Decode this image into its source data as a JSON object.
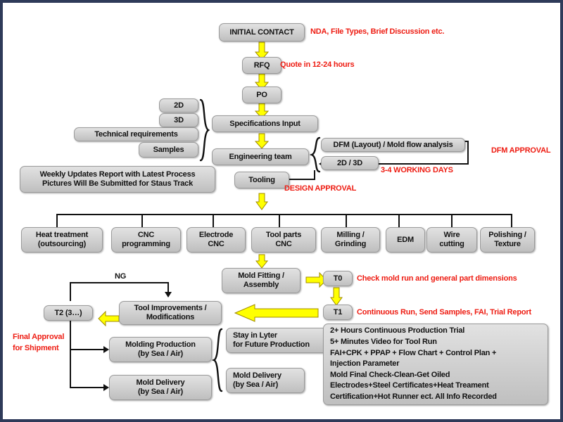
{
  "diagram": {
    "title": "Mold Manufacturing Process Flow",
    "colors": {
      "frame_border": "#2e3a59",
      "background": "#ffffff",
      "box_fill": "#d2d2d2",
      "annotation_red": "#ee1c12",
      "arrow_yellow": "#ffff00",
      "connector_black": "#111111"
    },
    "nodes": {
      "initial_contact": "INITIAL CONTACT",
      "rfq": "RFQ",
      "po": "PO",
      "two_d": "2D",
      "three_d": "3D",
      "technical_requirements": "Technical requirements",
      "samples": "Samples",
      "specifications_input": "Specifications Input",
      "engineering_team": "Engineering team",
      "dfm_layout": "DFM (Layout) / Mold flow analysis",
      "two_d_three_d": "2D / 3D",
      "tooling": "Tooling",
      "weekly_updates": "Weekly Updates Report with Latest Process\nPictures Will Be Submitted for Staus Track",
      "heat_treatment": "Heat treatment\n(outsourcing)",
      "cnc_programming": "CNC\nprogramming",
      "electrode_cnc": "Electrode\nCNC",
      "tool_parts_cnc": "Tool parts\nCNC",
      "milling_grinding": "Milling /\nGrinding",
      "edm": "EDM",
      "wire_cutting": "Wire\ncutting",
      "polishing_texture": "Polishing /\nTexture",
      "mold_fitting": "Mold Fitting /\nAssembly",
      "t0": "T0",
      "t1": "T1",
      "t2": "T2 (3…)",
      "tool_improvements": "Tool Improvements /\nModifications",
      "molding_production": "Molding Production\n(by Sea / Air)",
      "mold_delivery_left": "Mold Delivery\n(by Sea / Air)",
      "stay_in_lyter": "Stay in Lyter\nfor Future Production",
      "mold_delivery_right": "Mold Delivery\n(by Sea / Air)",
      "checklist": "2+ Hours Continuous Production Trial\n5+ Minutes Video for Tool Run\nFAI+CPK + PPAP + Flow Chart + Control Plan +\nInjection Parameter\nMold Final Check-Clean-Get Oiled\nElectrodes+Steel Certificates+Heat Treament\nCertification+Hot Runner ect. All Info  Recorded"
    },
    "annotations": {
      "nda": "NDA, File Types, Brief Discussion etc.",
      "quote": "Quote in 12-24 hours",
      "dfm_approval": "DFM APPROVAL",
      "working_days": "3-4 WORKING DAYS",
      "design_approval": "DESIGN APPROVAL",
      "check_mold_run": "Check mold run and general part dimensions",
      "continuous_run": "Continuous Run, Send Samples,  FAI, Trial Report",
      "ng": "NG",
      "final_approval": "Final Approval\nfor Shipment"
    }
  }
}
